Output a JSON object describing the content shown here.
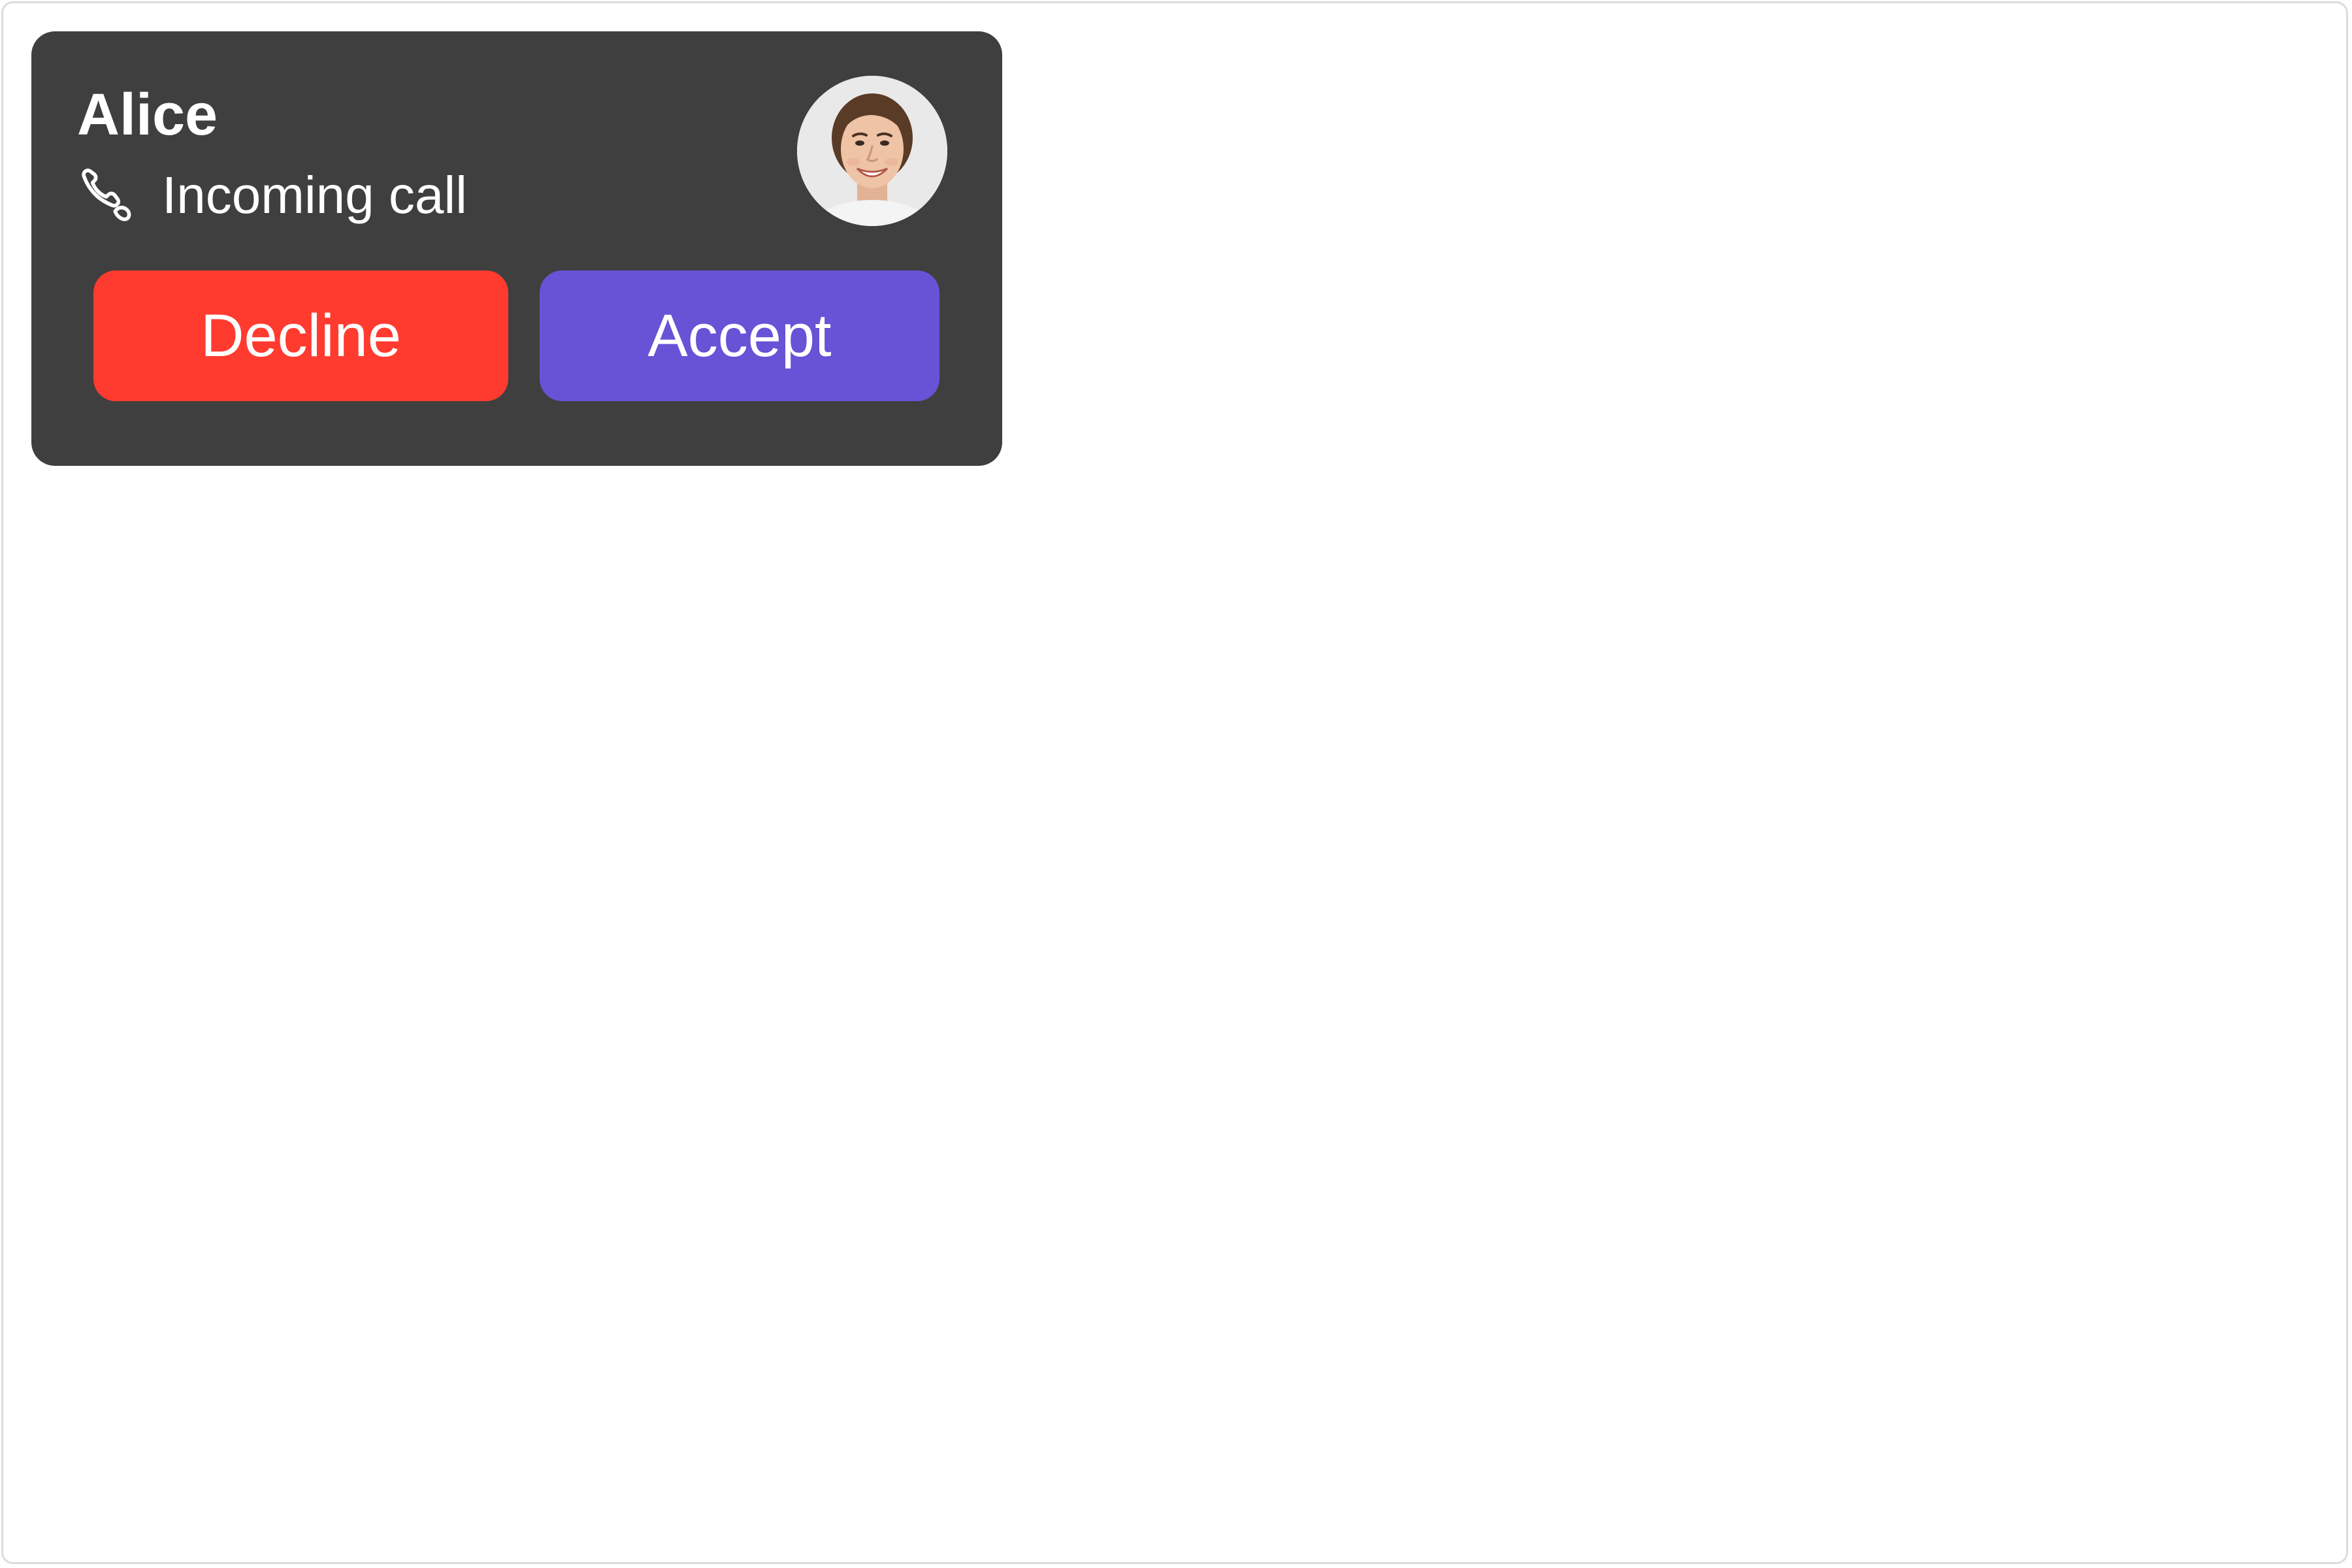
{
  "call": {
    "caller_name": "Alice",
    "status": "Incoming call",
    "status_icon": "phone-icon",
    "avatar": "caller-avatar-photo"
  },
  "actions": {
    "decline_label": "Decline",
    "accept_label": "Accept"
  },
  "colors": {
    "card_background": "#3f3f3f",
    "decline": "#ff3b30",
    "accept": "#6852d6",
    "text": "#ffffff",
    "page_background": "#ffffff"
  }
}
